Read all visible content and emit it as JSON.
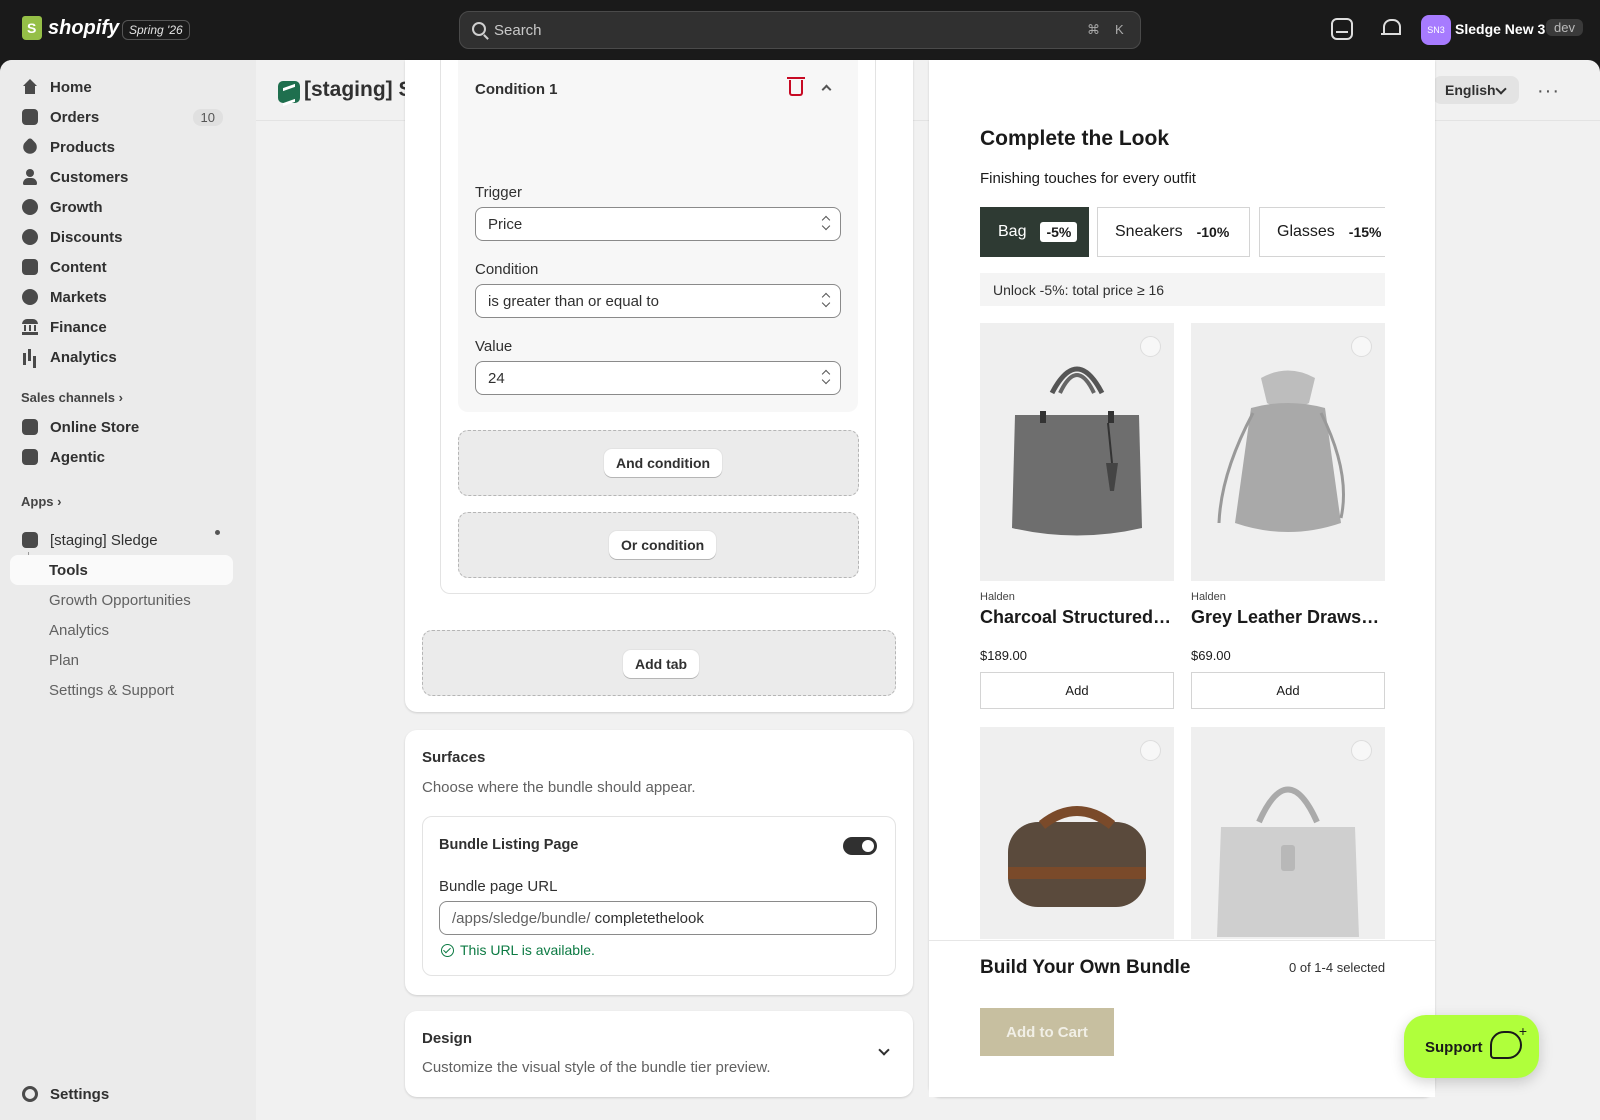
{
  "topbar": {
    "logo_text": "shopify",
    "edition": "Spring '26",
    "search_placeholder": "Search",
    "shortcut_cmd": "⌘",
    "shortcut_key": "K",
    "avatar_initials": "SN3",
    "store_name": "Sledge New 3",
    "dev_badge": "dev"
  },
  "sidebar": {
    "items": [
      {
        "label": "Home",
        "icon": "home-icon"
      },
      {
        "label": "Orders",
        "icon": "orders-icon",
        "badge": "10"
      },
      {
        "label": "Products",
        "icon": "tag-icon"
      },
      {
        "label": "Customers",
        "icon": "person-icon"
      },
      {
        "label": "Growth",
        "icon": "growth-icon"
      },
      {
        "label": "Discounts",
        "icon": "discount-icon"
      },
      {
        "label": "Content",
        "icon": "content-icon"
      },
      {
        "label": "Markets",
        "icon": "globe-icon"
      },
      {
        "label": "Finance",
        "icon": "bank-icon"
      },
      {
        "label": "Analytics",
        "icon": "bar-chart-icon"
      }
    ],
    "sales_channels_header": "Sales channels",
    "channels": [
      {
        "label": "Online Store",
        "icon": "store-icon"
      },
      {
        "label": "Agentic",
        "icon": "agentic-icon"
      }
    ],
    "apps_header": "Apps",
    "app_name": "[staging] Sledge",
    "app_subitems": [
      "Tools",
      "Growth Opportunities",
      "Analytics",
      "Plan",
      "Settings & Support"
    ],
    "settings": "Settings"
  },
  "header": {
    "title": "[staging] Sledge",
    "language": "English",
    "more": "···"
  },
  "condition": {
    "title": "Condition 1",
    "trigger_label": "Trigger",
    "trigger_value": "Price",
    "condition_label": "Condition",
    "condition_value": "is greater than or equal to",
    "value_label": "Value",
    "value_value": "24",
    "and_button": "And condition",
    "or_button": "Or condition",
    "add_tab_button": "Add tab"
  },
  "surfaces": {
    "title": "Surfaces",
    "description": "Choose where the bundle should appear.",
    "listing_label": "Bundle Listing Page",
    "listing_enabled": true,
    "url_label": "Bundle page URL",
    "url_prefix": "/apps/sledge/bundle/",
    "url_value": "completethelook",
    "url_status": "This URL is available."
  },
  "design": {
    "title": "Design",
    "description": "Customize the visual style of the bundle tier preview."
  },
  "preview": {
    "title": "Complete the Look",
    "subtitle": "Finishing touches for every outfit",
    "tiers": [
      {
        "label": "Bag",
        "discount": "-5%",
        "active": true
      },
      {
        "label": "Sneakers",
        "discount": "-10%",
        "active": false
      },
      {
        "label": "Glasses",
        "discount": "-15%",
        "active": false
      }
    ],
    "unlock_text": "Unlock -5%: total price ≥ 16",
    "products": [
      {
        "vendor": "Halden",
        "name": "Charcoal Structured Tote",
        "price": "$189.00",
        "add": "Add"
      },
      {
        "vendor": "Halden",
        "name": "Grey Leather Drawstring Bag",
        "price": "$69.00",
        "add": "Add"
      }
    ],
    "build_title": "Build Your Own Bundle",
    "selection_count": "0 of 1-4 selected",
    "cart_button": "Add to Cart"
  },
  "support": {
    "label": "Support"
  },
  "colors": {
    "topbar": "#1a1a1a",
    "active_tier": "#2e3a33",
    "support_button": "#b0ff3b",
    "success_text": "#0c7a43",
    "delete_icon": "#c70a24",
    "disabled_cart": "#c7bfa0"
  }
}
